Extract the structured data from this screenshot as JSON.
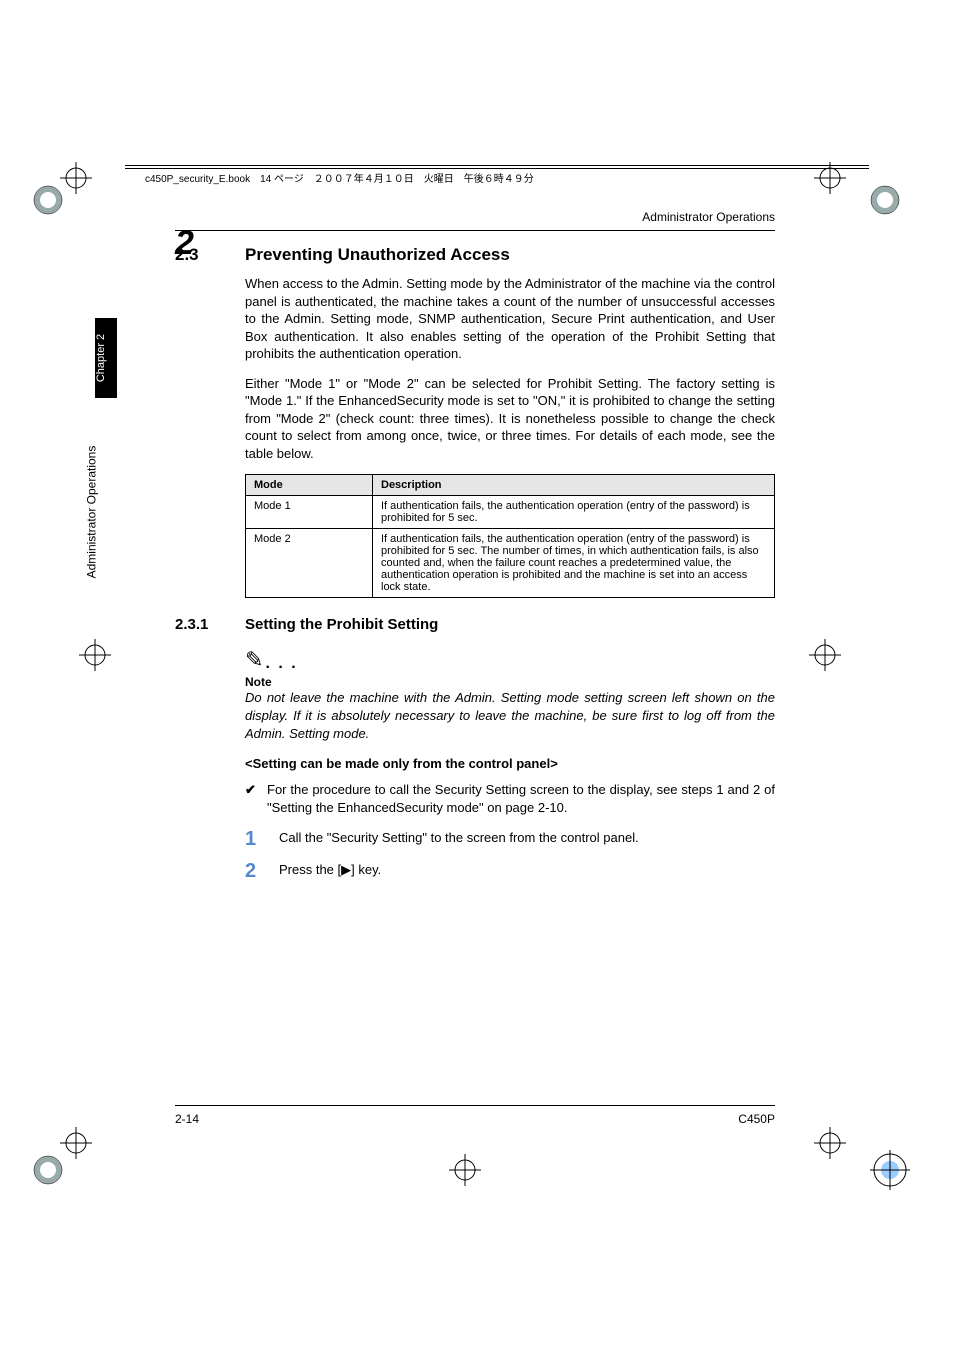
{
  "header": {
    "file_label": "c450P_security_E.book　14 ページ　２００７年４月１０日　火曜日　午後６時４９分"
  },
  "running_head": "Administrator Operations",
  "chapter_num": "2",
  "side_tab": "Chapter 2",
  "side_text": "Administrator Operations",
  "section": {
    "num": "2.3",
    "title": "Preventing Unauthorized Access",
    "para1": "When access to the Admin. Setting mode by the Administrator of the machine via the control panel is authenticated, the machine takes a count of the number of unsuccessful accesses to the Admin. Setting mode, SNMP authentication, Secure Print authentication, and User Box authentication. It also enables setting of the operation of the Prohibit Setting that prohibits the authentication operation.",
    "para2": "Either \"Mode 1\" or \"Mode 2\" can be selected for Prohibit Setting. The factory setting is \"Mode 1.\" If the EnhancedSecurity mode is set to \"ON,\" it is prohibited to change the setting from \"Mode 2\" (check count: three times). It is nonetheless possible to change the check count to select from among once, twice, or three times. For details of each mode, see the table below."
  },
  "table": {
    "head_mode": "Mode",
    "head_desc": "Description",
    "rows": [
      {
        "mode": "Mode 1",
        "desc": "If authentication fails, the authentication operation (entry of the password) is prohibited for 5 sec."
      },
      {
        "mode": "Mode 2",
        "desc": "If authentication fails, the authentication operation (entry of the password) is prohibited for 5 sec. The number of times, in which authentication fails, is also counted and, when the failure count reaches a predetermined value, the authentication operation is prohibited and the machine is set into an access lock state."
      }
    ]
  },
  "subsection": {
    "num": "2.3.1",
    "title": "Setting the Prohibit Setting",
    "note_label": "Note",
    "note_body": "Do not leave the machine with the Admin. Setting mode setting screen left shown on the display. If it is absolutely necessary to leave the machine, be sure first to log off from the Admin. Setting mode.",
    "sub_bold": "<Setting can be made only from the control panel>",
    "check": "For the procedure to call the Security Setting screen to the display, see steps 1 and 2 of \"Setting the EnhancedSecurity mode\" on page 2-10.",
    "steps": [
      {
        "n": "1",
        "text": "Call the \"Security Setting\" to the screen from the control panel."
      },
      {
        "n": "2",
        "text": "Press the [▶] key."
      }
    ]
  },
  "footer": {
    "left": "2-14",
    "right": "C450P"
  }
}
